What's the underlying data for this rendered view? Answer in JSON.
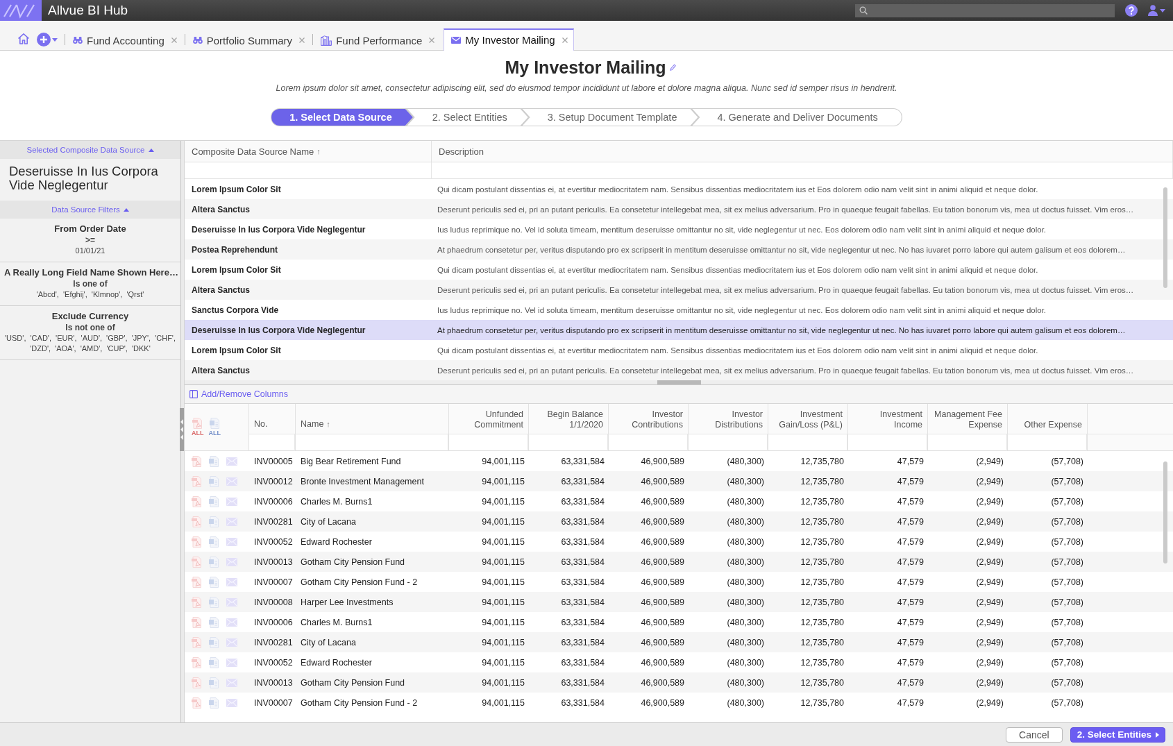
{
  "app_bar": {
    "title": "Allvue BI Hub"
  },
  "tabs": [
    {
      "label": "Fund Accounting",
      "kind": "analysis",
      "selected": false
    },
    {
      "label": "Portfolio Summary",
      "kind": "analysis",
      "selected": false
    },
    {
      "label": "Fund Performance",
      "kind": "dashboard",
      "selected": false
    },
    {
      "label": "My Investor Mailing",
      "kind": "mailing",
      "selected": true
    }
  ],
  "page": {
    "title": "My Investor Mailing",
    "description": "Lorem ipsum dolor sit amet, consectetur adipiscing elit, sed do eiusmod tempor incididunt ut labore et dolore magna aliqua. Nunc sed id semper risus in hendrerit."
  },
  "steps": [
    {
      "label": "1. Select Data Source",
      "selected": true
    },
    {
      "label": "2. Select Entities",
      "selected": false
    },
    {
      "label": "3. Setup Document Template",
      "selected": false
    },
    {
      "label": "4. Generate and Deliver Documents",
      "selected": false
    }
  ],
  "sidebar": {
    "source_heading": "Selected Composite Data Source",
    "source_expanded": true,
    "selected_source": "Deseruisse In Ius Corpora Vide Neglegentur",
    "filters_heading": "Data Source Filters",
    "filters_expanded": true,
    "filters": [
      {
        "field": "From Order Date",
        "operator": ">=",
        "values": "01/01/21"
      },
      {
        "field": "A Really Long Field Name Shown Here…",
        "operator": "Is one of",
        "values": "'Abcd', 'Efghij', 'Klmnop', 'Qrst'"
      },
      {
        "field": "Exclude Currency",
        "operator": "Is not one of",
        "values": "'USD', 'CAD', 'EUR', 'AUD', 'GBP', 'JPY', 'CHF', 'DZD', 'AOA', 'AMD', 'CUP', 'DKK'"
      }
    ]
  },
  "data_sources": {
    "columns": [
      {
        "label": "Composite Data Source Name",
        "sort_arrow": "↑"
      },
      {
        "label": "Description"
      }
    ],
    "rows": [
      {
        "name": "Lorem Ipsum Color Sit",
        "description": "Qui dicam postulant dissentias ei, at evertitur mediocritatem nam. Sensibus dissentias mediocritatem ius et Eos dolorem odio nam velit sint in animi aliquid et neque dolor.",
        "selected": false
      },
      {
        "name": "Altera Sanctus",
        "description": "Deserunt periculis sed ei, pri an putant periculis. Ea consetetur intellegebat mea, sit ex melius adversarium. Pro in quaeque feugait fabellas. Eu tation bonorum vis, mea ut doctus fuisset. Vim eros…",
        "selected": false
      },
      {
        "name": "Deseruisse In Ius Corpora Vide Neglegentur",
        "description": "Ius ludus reprimique no. Vel id soluta timeam, mentitum deseruisse omittantur no sit, vide neglegentur ut nec. Eos dolorem odio nam velit sint in animi aliquid et neque dolor.",
        "selected": false
      },
      {
        "name": "Postea Reprehendunt",
        "description": "At phaedrum consetetur per, veritus disputando pro ex scripserit in mentitum deseruisse omittantur no sit, vide neglegentur ut nec. No has iuvaret porro labore qui autem galisum et eos dolorem…",
        "selected": false
      },
      {
        "name": "Lorem Ipsum Color Sit",
        "description": "Qui dicam postulant dissentias ei, at evertitur mediocritatem nam. Sensibus dissentias mediocritatem ius et Eos dolorem odio nam velit sint in animi aliquid et neque dolor.",
        "selected": false
      },
      {
        "name": "Altera Sanctus",
        "description": "Deserunt periculis sed ei, pri an putant periculis. Ea consetetur intellegebat mea, sit ex melius adversarium. Pro in quaeque feugait fabellas. Eu tation bonorum vis, mea ut doctus fuisset. Vim eros…",
        "selected": false
      },
      {
        "name": "Sanctus Corpora Vide",
        "description": "Ius ludus reprimique no. Vel id soluta timeam, mentitum deseruisse omittantur no sit, vide neglegentur ut nec. Eos dolorem odio nam velit sint in animi aliquid et neque dolor.",
        "selected": false
      },
      {
        "name": "Deseruisse In Ius Corpora Vide Neglegentur",
        "description": "At phaedrum consetetur per, veritus disputando pro ex scripserit in mentitum deseruisse omittantur no sit, vide neglegentur ut nec. No has iuvaret porro labore qui autem galisum et eos dolorem…",
        "selected": true
      },
      {
        "name": "Lorem Ipsum Color Sit",
        "description": "Qui dicam postulant dissentias ei, at evertitur mediocritatem nam. Sensibus dissentias mediocritatem ius et Eos dolorem odio nam velit sint in animi aliquid et neque dolor.",
        "selected": false
      },
      {
        "name": "Altera Sanctus",
        "description": "Deserunt periculis sed ei, pri an putant periculis. Ea consetetur intellegebat mea, sit ex melius adversarium. Pro in quaeque feugait fabellas. Eu tation bonorum vis, mea ut doctus fuisset. Vim eros…",
        "selected": false
      }
    ]
  },
  "investors": {
    "columns_link": "Add/Remove Columns",
    "bulk_actions": [
      {
        "kind": "pdf",
        "label": "ALL"
      },
      {
        "kind": "word",
        "label": "ALL"
      }
    ],
    "columns": [
      {
        "label": "No.",
        "kind": "text"
      },
      {
        "label": "Name",
        "kind": "text",
        "sort_arrow": "↑"
      },
      {
        "label": "Unfunded Commitment",
        "kind": "number"
      },
      {
        "label": "Begin Balance 1/1/2020",
        "kind": "number"
      },
      {
        "label": "Investor Contributions",
        "kind": "number"
      },
      {
        "label": "Investor Distributions",
        "kind": "number"
      },
      {
        "label": "Investment Gain/Loss (P&L)",
        "kind": "number"
      },
      {
        "label": "Investment Income",
        "kind": "number"
      },
      {
        "label": "Management Fee Expense",
        "kind": "number"
      },
      {
        "label": "Other Expense",
        "kind": "number"
      }
    ],
    "rows": [
      {
        "cells": [
          "INV00005",
          "Big Bear Retirement Fund",
          "94,001,115",
          "63,331,584",
          "46,900,589",
          "(480,300)",
          "12,735,780",
          "47,579",
          "(2,949)",
          "(57,708)"
        ]
      },
      {
        "cells": [
          "INV00012",
          "Bronte Investment Management",
          "94,001,115",
          "63,331,584",
          "46,900,589",
          "(480,300)",
          "12,735,780",
          "47,579",
          "(2,949)",
          "(57,708)"
        ]
      },
      {
        "cells": [
          "INV00006",
          "Charles M. Burns1",
          "94,001,115",
          "63,331,584",
          "46,900,589",
          "(480,300)",
          "12,735,780",
          "47,579",
          "(2,949)",
          "(57,708)"
        ]
      },
      {
        "cells": [
          "INV00281",
          "City of Lacana",
          "94,001,115",
          "63,331,584",
          "46,900,589",
          "(480,300)",
          "12,735,780",
          "47,579",
          "(2,949)",
          "(57,708)"
        ]
      },
      {
        "cells": [
          "INV00052",
          "Edward Rochester",
          "94,001,115",
          "63,331,584",
          "46,900,589",
          "(480,300)",
          "12,735,780",
          "47,579",
          "(2,949)",
          "(57,708)"
        ]
      },
      {
        "cells": [
          "INV00013",
          "Gotham City Pension Fund",
          "94,001,115",
          "63,331,584",
          "46,900,589",
          "(480,300)",
          "12,735,780",
          "47,579",
          "(2,949)",
          "(57,708)"
        ]
      },
      {
        "cells": [
          "INV00007",
          "Gotham City Pension Fund - 2",
          "94,001,115",
          "63,331,584",
          "46,900,589",
          "(480,300)",
          "12,735,780",
          "47,579",
          "(2,949)",
          "(57,708)"
        ]
      },
      {
        "cells": [
          "INV00008",
          "Harper Lee Investments",
          "94,001,115",
          "63,331,584",
          "46,900,589",
          "(480,300)",
          "12,735,780",
          "47,579",
          "(2,949)",
          "(57,708)"
        ]
      },
      {
        "cells": [
          "INV00006",
          "Charles M. Burns1",
          "94,001,115",
          "63,331,584",
          "46,900,589",
          "(480,300)",
          "12,735,780",
          "47,579",
          "(2,949)",
          "(57,708)"
        ]
      },
      {
        "cells": [
          "INV00281",
          "City of Lacana",
          "94,001,115",
          "63,331,584",
          "46,900,589",
          "(480,300)",
          "12,735,780",
          "47,579",
          "(2,949)",
          "(57,708)"
        ]
      },
      {
        "cells": [
          "INV00052",
          "Edward Rochester",
          "94,001,115",
          "63,331,584",
          "46,900,589",
          "(480,300)",
          "12,735,780",
          "47,579",
          "(2,949)",
          "(57,708)"
        ]
      },
      {
        "cells": [
          "INV00013",
          "Gotham City Pension Fund",
          "94,001,115",
          "63,331,584",
          "46,900,589",
          "(480,300)",
          "12,735,780",
          "47,579",
          "(2,949)",
          "(57,708)"
        ]
      },
      {
        "cells": [
          "INV00007",
          "Gotham City Pension Fund - 2",
          "94,001,115",
          "63,331,584",
          "46,900,589",
          "(480,300)",
          "12,735,780",
          "47,579",
          "(2,949)",
          "(57,708)"
        ]
      }
    ]
  },
  "footer": {
    "buttons": [
      {
        "label": "Cancel",
        "kind": "secondary"
      },
      {
        "label": "2. Select Entities",
        "kind": "primary"
      }
    ]
  }
}
